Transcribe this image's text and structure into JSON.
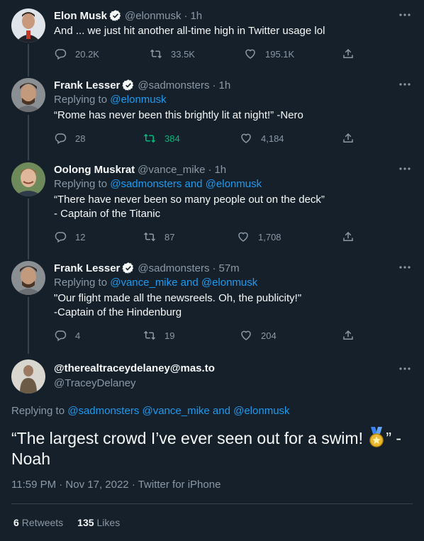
{
  "colors": {
    "bg": "#15202b",
    "text": "#f7f9f9",
    "muted": "#8b98a5",
    "link": "#1d9bf0",
    "retweet": "#00ba7c",
    "line": "#38444d"
  },
  "tweets": [
    {
      "name": "Elon Musk",
      "handle": "@elonmusk",
      "time": "1h",
      "reply_label": "",
      "mentions": "",
      "text": "And ... we just hit another all-time high in Twitter usage lol",
      "replies": "20.2K",
      "retweets": "33.5K",
      "likes": "195.1K",
      "avatar": "elon-musk-avatar"
    },
    {
      "name": "Frank Lesser",
      "handle": "@sadmonsters",
      "time": "1h",
      "reply_label": "Replying to ",
      "mentions": "@elonmusk",
      "text": "“Rome has never been this brightly lit at night!” -Nero",
      "replies": "28",
      "retweets": "384",
      "likes": "4,184",
      "avatar": "frank-lesser-avatar"
    },
    {
      "name": "Oolong Muskrat",
      "handle": "@vance_mike",
      "time": "1h",
      "reply_label": "Replying to ",
      "mentions": "@sadmonsters and @elonmusk",
      "text": "“There have never been so many people out on the deck”\n- Captain of the Titanic",
      "replies": "12",
      "retweets": "87",
      "likes": "1,708",
      "avatar": "oolong-muskrat-avatar"
    },
    {
      "name": "Frank Lesser",
      "handle": "@sadmonsters",
      "time": "57m",
      "reply_label": "Replying to ",
      "mentions": "@vance_mike and @elonmusk",
      "text": "\"Our flight made all the newsreels. Oh, the publicity!\"\n-Captain of the Hindenburg",
      "replies": "4",
      "retweets": "19",
      "likes": "204",
      "avatar": "frank-lesser-avatar"
    }
  ],
  "main": {
    "name": "@therealtraceydelaney@mas.to",
    "handle": "@TraceyDelaney",
    "reply_label": "Replying to ",
    "mentions": "@sadmonsters @vance_mike and @elonmusk",
    "text_before": "“The largest crowd I’ve ever seen out for a swim! ",
    "text_after": "” - Noah",
    "timestamp": "11:59 PM · Nov 17, 2022 · Twitter for iPhone",
    "retweets_count": "6",
    "retweets_label": "Retweets",
    "likes_count": "135",
    "likes_label": "Likes",
    "avatar": "tracey-delaney-avatar",
    "emoji": "medal-icon"
  }
}
